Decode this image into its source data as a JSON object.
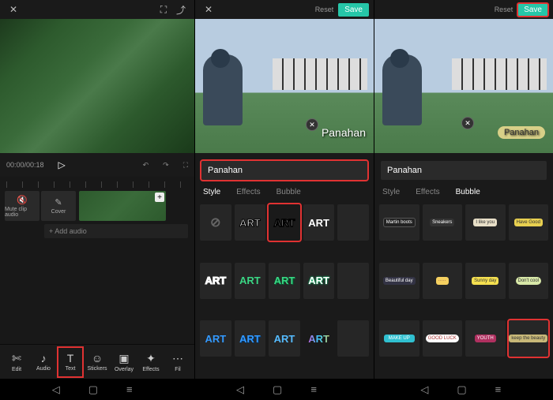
{
  "panel1": {
    "timecode": "00:00/00:18",
    "tracks": {
      "mute_label": "Mute clip audio",
      "cover_label": "Cover",
      "add_audio": "+ Add audio"
    },
    "bottom_tools": [
      {
        "icon": "✄",
        "label": "Edit"
      },
      {
        "icon": "♪",
        "label": "Audio"
      },
      {
        "icon": "T",
        "label": "Text"
      },
      {
        "icon": "☺",
        "label": "Stickers"
      },
      {
        "icon": "▣",
        "label": "Overlay"
      },
      {
        "icon": "✦",
        "label": "Effects"
      },
      {
        "icon": "⋯",
        "label": "Fil"
      }
    ]
  },
  "panel2": {
    "reset": "Reset",
    "save": "Save",
    "caption": "Panahan",
    "input_value": "Panahan",
    "tabs": [
      "Style",
      "Effects",
      "Bubble"
    ],
    "art_text": "ART"
  },
  "panel3": {
    "reset": "Reset",
    "save": "Save",
    "caption": "Panahan",
    "input_value": "Panahan",
    "tabs": [
      "Style",
      "Effects",
      "Bubble"
    ],
    "bubbles": [
      "Martin boots",
      "Sneakers",
      "I like you",
      "Have Good",
      "Beautiful day",
      "·····",
      "Sunny day",
      "Don't cool",
      "MAKE UP",
      "GOOD LUCK",
      "YOUTH",
      "keep the beauty"
    ]
  },
  "colors": {
    "accent": "#26c6a8",
    "highlight": "#e03232"
  }
}
